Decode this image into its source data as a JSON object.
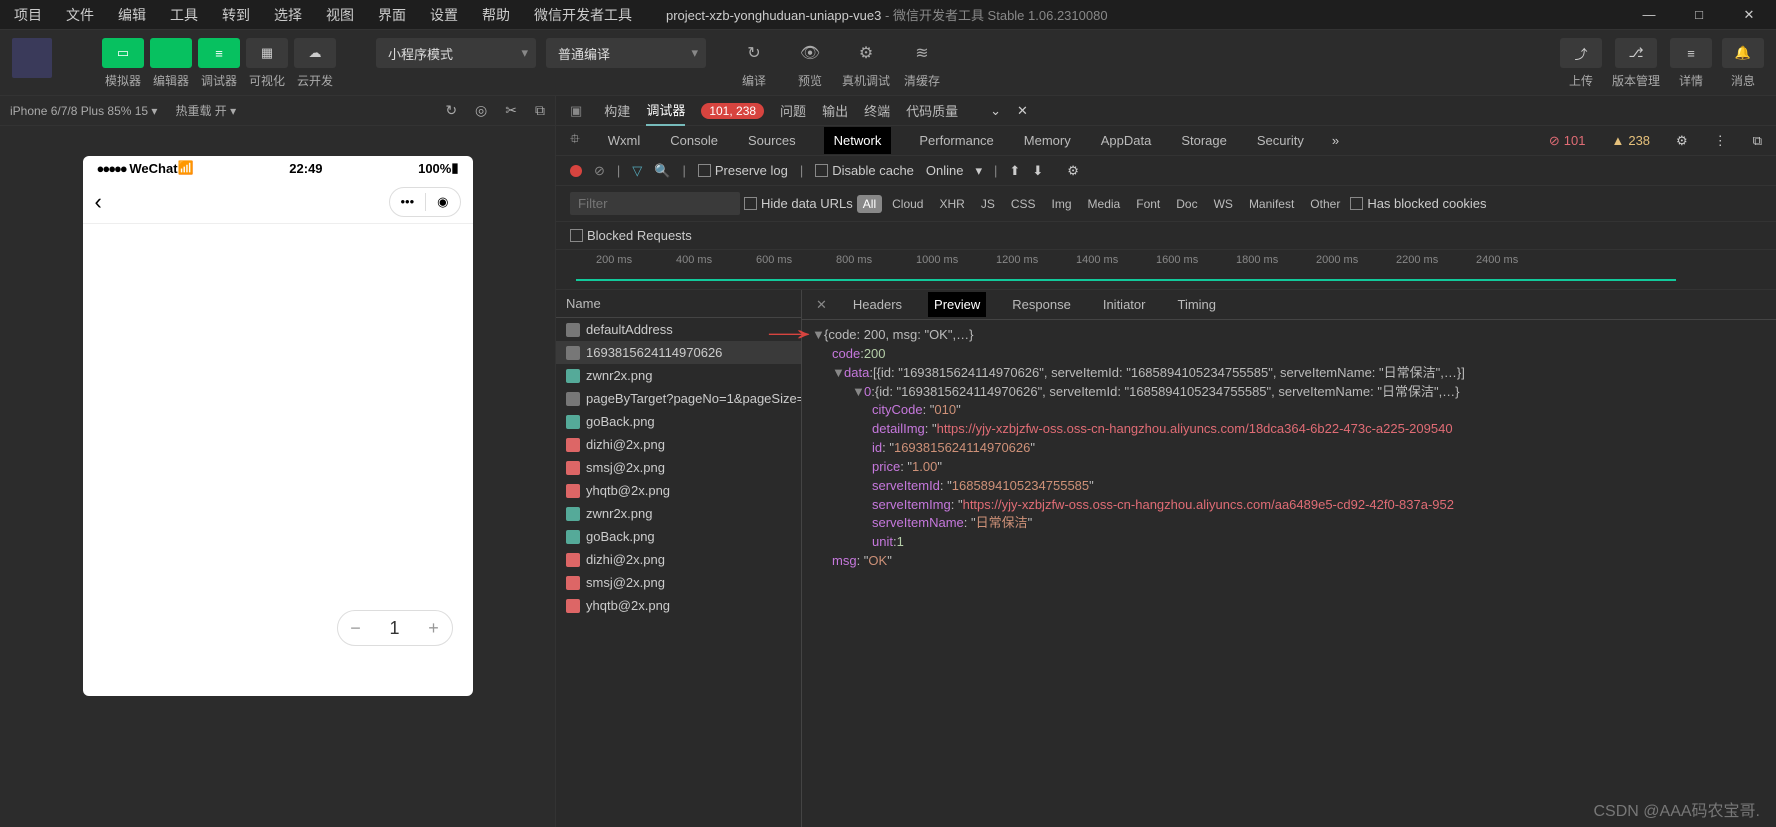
{
  "menu": [
    "项目",
    "文件",
    "编辑",
    "工具",
    "转到",
    "选择",
    "视图",
    "界面",
    "设置",
    "帮助",
    "微信开发者工具"
  ],
  "title": {
    "name": "project-xzb-yonghuduan-uniapp-vue3",
    "sub": "- 微信开发者工具 Stable 1.06.2310080"
  },
  "toolGroups": {
    "left": [
      {
        "key": "simulator",
        "lbl": "模拟器",
        "glyph": "▭",
        "green": true
      },
      {
        "key": "editor",
        "lbl": "编辑器",
        "glyph": "</>",
        "green": true
      },
      {
        "key": "debugger",
        "lbl": "调试器",
        "glyph": "≡",
        "green": true
      },
      {
        "key": "visual",
        "lbl": "可视化",
        "glyph": "▦",
        "green": false
      },
      {
        "key": "cloud",
        "lbl": "云开发",
        "glyph": "☁",
        "green": false
      }
    ],
    "mode": "小程序模式",
    "compile": "普通编译",
    "center": [
      {
        "lbl": "编译",
        "glyph": "↻"
      },
      {
        "lbl": "预览",
        "glyph": "👁"
      },
      {
        "lbl": "真机调试",
        "glyph": "⚙"
      },
      {
        "lbl": "清缓存",
        "glyph": "≋"
      }
    ],
    "right": [
      {
        "lbl": "上传",
        "glyph": "⤴"
      },
      {
        "lbl": "版本管理",
        "glyph": "⎇"
      },
      {
        "lbl": "详情",
        "glyph": "≡"
      },
      {
        "lbl": "消息",
        "glyph": "🔔"
      }
    ]
  },
  "simBar": {
    "device": "iPhone 6/7/8 Plus 85% 15 ▾",
    "hot": "热重载 开 ▾"
  },
  "phone": {
    "signal": "●●●●●",
    "carrier": "WeChat",
    "wifi": "📶",
    "time": "22:49",
    "battText": "100%",
    "stepVal": "1"
  },
  "dbgTabs": {
    "items": [
      "构建",
      "调试器"
    ],
    "active": "调试器",
    "badge": "101, 238",
    "more": [
      "问题",
      "输出",
      "终端",
      "代码质量"
    ]
  },
  "devTabs": {
    "items": [
      "Wxml",
      "Console",
      "Sources",
      "Network",
      "Performance",
      "Memory",
      "AppData",
      "Storage",
      "Security"
    ],
    "active": "Network",
    "err": "101",
    "warn": "238"
  },
  "netCtl": {
    "preserve": "Preserve log",
    "disable": "Disable cache",
    "online": "Online"
  },
  "filter": {
    "placeholder": "Filter",
    "hide": "Hide data URLs",
    "chips": [
      "All",
      "Cloud",
      "XHR",
      "JS",
      "CSS",
      "Img",
      "Media",
      "Font",
      "Doc",
      "WS",
      "Manifest",
      "Other"
    ],
    "blockedCookies": "Has blocked cookies",
    "blockedReq": "Blocked Requests"
  },
  "ticks": [
    "200 ms",
    "400 ms",
    "600 ms",
    "800 ms",
    "1000 ms",
    "1200 ms",
    "1400 ms",
    "1600 ms",
    "1800 ms",
    "2000 ms",
    "2200 ms",
    "2400 ms"
  ],
  "reqHdr": "Name",
  "requests": [
    {
      "name": "defaultAddress",
      "ico": "doc"
    },
    {
      "name": "1693815624114970626",
      "ico": "doc",
      "active": true
    },
    {
      "name": "zwnr2x.png",
      "ico": "img"
    },
    {
      "name": "pageByTarget?pageNo=1&pageSize=...",
      "ico": "doc"
    },
    {
      "name": "goBack.png",
      "ico": "img"
    },
    {
      "name": "dizhi@2x.png",
      "ico": "red"
    },
    {
      "name": "smsj@2x.png",
      "ico": "red"
    },
    {
      "name": "yhqtb@2x.png",
      "ico": "red"
    },
    {
      "name": "zwnr2x.png",
      "ico": "img"
    },
    {
      "name": "goBack.png",
      "ico": "img"
    },
    {
      "name": "dizhi@2x.png",
      "ico": "red"
    },
    {
      "name": "smsj@2x.png",
      "ico": "red"
    },
    {
      "name": "yhqtb@2x.png",
      "ico": "red"
    }
  ],
  "detailTabs": {
    "items": [
      "Headers",
      "Preview",
      "Response",
      "Initiator",
      "Timing"
    ],
    "active": "Preview"
  },
  "chart_data": {
    "type": "table",
    "response": {
      "summary": "{code: 200, msg: \"OK\",…}",
      "code": 200,
      "msg": "OK",
      "data_summary": "[{id: \"1693815624114970626\", serveItemId: \"1685894105234755585\", serveItemName: \"日常保洁\",…}]",
      "item0_summary": "{id: \"1693815624114970626\", serveItemId: \"1685894105234755585\", serveItemName: \"日常保洁\",…}",
      "item0": {
        "cityCode": "010",
        "detailImg": "https://yjy-xzbjzfw-oss.oss-cn-hangzhou.aliyuncs.com/18dca364-6b22-473c-a225-209540",
        "id": "1693815624114970626",
        "price": "1.00",
        "serveItemId": "1685894105234755585",
        "serveItemImg": "https://yjy-xzbjzfw-oss.oss-cn-hangzhou.aliyuncs.com/aa6489e5-cd92-42f0-837a-952",
        "serveItemName": "日常保洁",
        "unit": 1
      }
    }
  },
  "watermark": "CSDN @AAA码农宝哥."
}
